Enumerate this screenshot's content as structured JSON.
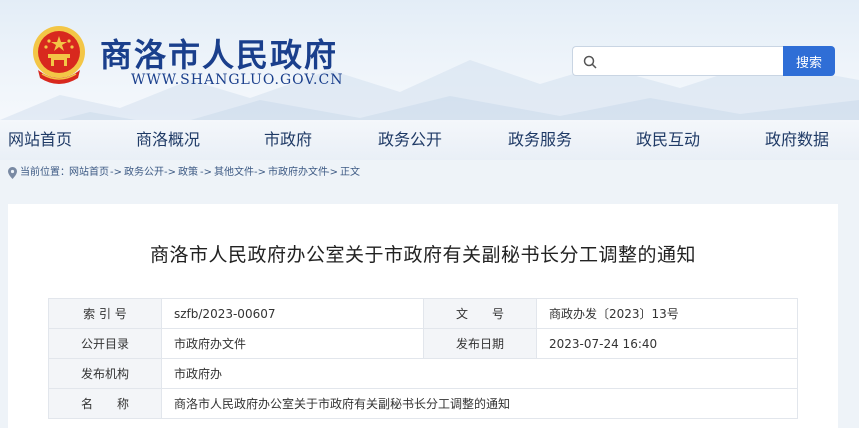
{
  "header": {
    "site_name": "商洛市人民政府",
    "site_url": "WWW.SHANGLUO.GOV.CN",
    "search": {
      "placeholder": "",
      "button_label": "搜索"
    }
  },
  "nav": {
    "items": [
      {
        "label": "网站首页"
      },
      {
        "label": "商洛概况"
      },
      {
        "label": "市政府"
      },
      {
        "label": "政务公开"
      },
      {
        "label": "政务服务"
      },
      {
        "label": "政民互动"
      },
      {
        "label": "政府数据"
      }
    ]
  },
  "breadcrumb": {
    "prefix": "当前位置：",
    "items": [
      "网站首页",
      "政务公开",
      "政策",
      "其他文件",
      "市政府办文件",
      "正文"
    ],
    "separator": "->"
  },
  "article": {
    "title": "商洛市人民政府办公室关于市政府有关副秘书长分工调整的通知",
    "meta": {
      "index_label": "索 引 号",
      "index_value": "szfb/2023-00607",
      "doc_no_label": "文　　号",
      "doc_no_value": "商政办发〔2023〕13号",
      "catalog_label": "公开目录",
      "catalog_value": "市政府办文件",
      "date_label": "发布日期",
      "date_value": "2023-07-24 16:40",
      "org_label": "发布机构",
      "org_value": "市政府办",
      "name_label": "名　　称",
      "name_value": "商洛市人民政府办公室关于市政府有关副秘书长分工调整的通知"
    }
  },
  "colors": {
    "brand_blue": "#1a3f8c",
    "search_button": "#2f6ed6",
    "nav_text": "#1f3a66",
    "emblem_red": "#d8281e",
    "emblem_gold": "#f3c646"
  }
}
